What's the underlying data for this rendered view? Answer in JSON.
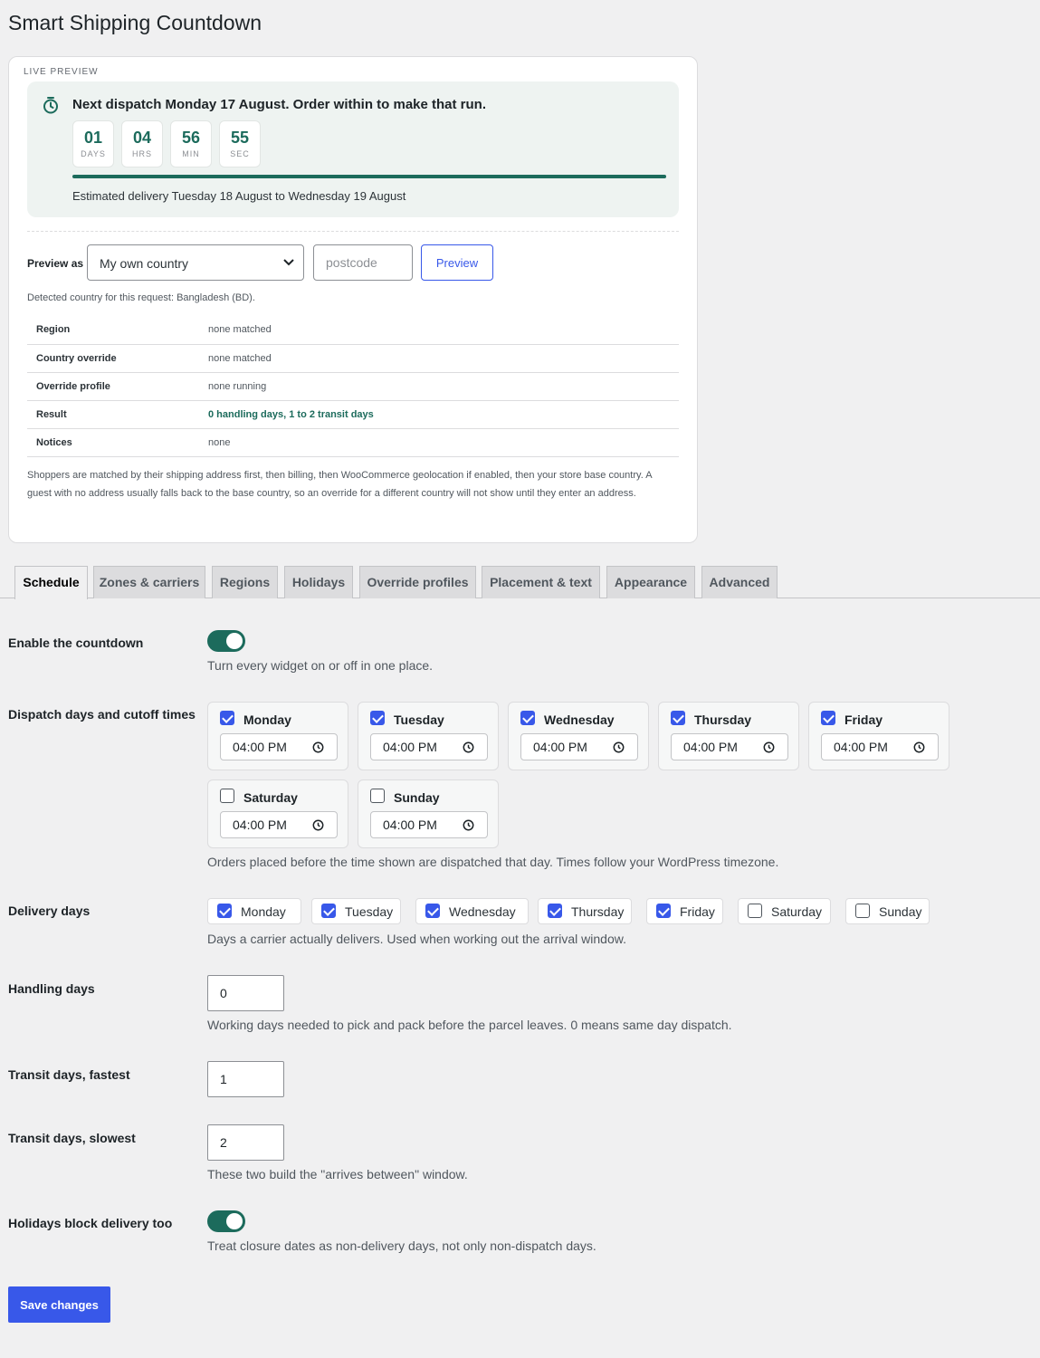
{
  "page": {
    "title": "Smart Shipping Countdown"
  },
  "preview": {
    "label": "LIVE PREVIEW",
    "banner_title": "Next dispatch Monday 17 August. Order within to make that run.",
    "countdown": [
      {
        "value": "01",
        "unit": "DAYS"
      },
      {
        "value": "04",
        "unit": "HRS"
      },
      {
        "value": "56",
        "unit": "MIN"
      },
      {
        "value": "55",
        "unit": "SEC"
      }
    ],
    "progress_fraction": 1.0,
    "estimated": "Estimated delivery Tuesday 18 August to Wednesday 19 August",
    "preview_as_label": "Preview as",
    "country_select_value": "My own country",
    "postcode_placeholder": "postcode",
    "preview_button": "Preview",
    "detected": "Detected country for this request: Bangladesh (BD).",
    "diagnostics": [
      {
        "key": "Region",
        "value": "none matched"
      },
      {
        "key": "Country override",
        "value": "none matched"
      },
      {
        "key": "Override profile",
        "value": "none running"
      },
      {
        "key": "Result",
        "value": "0 handling days, 1 to 2 transit days"
      },
      {
        "key": "Notices",
        "value": "none"
      }
    ],
    "note": "Shoppers are matched by their shipping address first, then billing, then WooCommerce geolocation if enabled, then your store base country. A guest with no address usually falls back to the base country, so an override for a different country will not show until they enter an address."
  },
  "tabs": [
    "Schedule",
    "Zones & carriers",
    "Regions",
    "Holidays",
    "Override profiles",
    "Placement & text",
    "Appearance",
    "Advanced"
  ],
  "active_tab": "Schedule",
  "schedule": {
    "enable": {
      "label": "Enable the countdown",
      "on": true,
      "desc": "Turn every widget on or off in one place."
    },
    "dispatch": {
      "label": "Dispatch days and cutoff times",
      "days": [
        {
          "name": "Monday",
          "checked": true,
          "time": "04:00 PM"
        },
        {
          "name": "Tuesday",
          "checked": true,
          "time": "04:00 PM"
        },
        {
          "name": "Wednesday",
          "checked": true,
          "time": "04:00 PM"
        },
        {
          "name": "Thursday",
          "checked": true,
          "time": "04:00 PM"
        },
        {
          "name": "Friday",
          "checked": true,
          "time": "04:00 PM"
        },
        {
          "name": "Saturday",
          "checked": false,
          "time": "04:00 PM"
        },
        {
          "name": "Sunday",
          "checked": false,
          "time": "04:00 PM"
        }
      ],
      "desc": "Orders placed before the time shown are dispatched that day. Times follow your WordPress timezone."
    },
    "delivery": {
      "label": "Delivery days",
      "days": [
        {
          "name": "Monday",
          "checked": true
        },
        {
          "name": "Tuesday",
          "checked": true
        },
        {
          "name": "Wednesday",
          "checked": true
        },
        {
          "name": "Thursday",
          "checked": true
        },
        {
          "name": "Friday",
          "checked": true
        },
        {
          "name": "Saturday",
          "checked": false
        },
        {
          "name": "Sunday",
          "checked": false
        }
      ],
      "desc": "Days a carrier actually delivers. Used when working out the arrival window."
    },
    "handling": {
      "label": "Handling days",
      "value": "0",
      "desc": "Working days needed to pick and pack before the parcel leaves. 0 means same day dispatch."
    },
    "transit_fast": {
      "label": "Transit days, fastest",
      "value": "1"
    },
    "transit_slow": {
      "label": "Transit days, slowest",
      "value": "2",
      "desc": "These two build the \"arrives between\" window."
    },
    "holidays": {
      "label": "Holidays block delivery too",
      "on": true,
      "desc": "Treat closure dates as non-delivery days, not only non-dispatch days."
    }
  },
  "save_button": "Save changes",
  "colors": {
    "accent": "#3858e9",
    "brand_green": "#1c6b5c",
    "banner_bg": "#eef3f1"
  },
  "icons": {
    "timer": "stopwatch-icon",
    "chevron": "chevron-down-icon",
    "clock": "clock-icon"
  }
}
